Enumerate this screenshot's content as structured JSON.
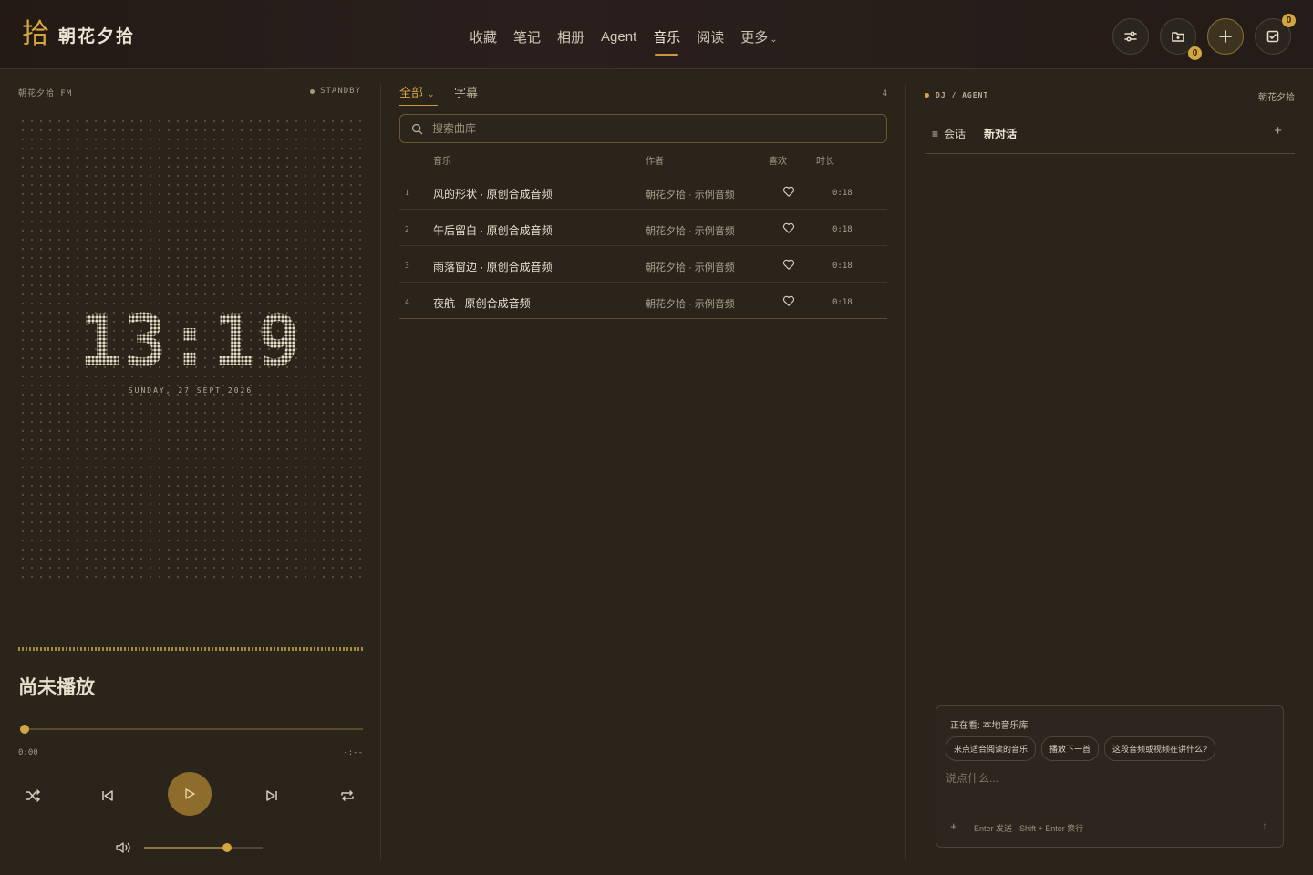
{
  "header": {
    "logo_mark": "拾",
    "brand": "朝花夕拾",
    "nav": [
      "收藏",
      "笔记",
      "相册",
      "Agent",
      "音乐",
      "阅读",
      "更多"
    ],
    "nav_more_caret": "⌄",
    "active_nav": "音乐",
    "folder_badge": "0",
    "tasks_badge": "0"
  },
  "player": {
    "station": "朝花夕拾 FM",
    "status": "STANDBY",
    "clock": "13:19",
    "date": "SUNDAY, 27 SEPT 2026",
    "now_playing": "尚未播放",
    "progress": 0,
    "time_current": "0:00",
    "time_total": "-:--",
    "volume": 0.7
  },
  "library": {
    "tabs": [
      "全部",
      "字幕"
    ],
    "tab_caret": "⌄",
    "count": "4",
    "search_placeholder": "搜索曲库",
    "columns": {
      "music": "音乐",
      "author": "作者",
      "like": "喜欢",
      "duration": "时长"
    },
    "tracks": [
      {
        "idx": "1",
        "title": "风的形状 · 原创合成音频",
        "author": "朝花夕拾 · 示例音频",
        "duration": "0:18"
      },
      {
        "idx": "2",
        "title": "午后留白 · 原创合成音频",
        "author": "朝花夕拾 · 示例音频",
        "duration": "0:18"
      },
      {
        "idx": "3",
        "title": "雨落窗边 · 原创合成音频",
        "author": "朝花夕拾 · 示例音频",
        "duration": "0:18"
      },
      {
        "idx": "4",
        "title": "夜航 · 原创合成音频",
        "author": "朝花夕拾 · 示例音频",
        "duration": "0:18"
      }
    ]
  },
  "agent": {
    "label": "DJ / AGENT",
    "brand": "朝花夕拾",
    "session_menu": "会话",
    "session_menu_icon": "≡",
    "session_title": "新对话",
    "session_add": "+",
    "viewing": "正在看: 本地音乐库",
    "suggestions": [
      "来点适合阅读的音乐",
      "播放下一首",
      "这段音频或视频在讲什么?"
    ],
    "input_placeholder": "说点什么...",
    "attach": "+",
    "hint": "Enter 发送 · Shift + Enter 换行",
    "send": "↑"
  },
  "colors": {
    "accent": "#d4a640",
    "background": "#2a241b",
    "panel_border": "#3d3628"
  }
}
